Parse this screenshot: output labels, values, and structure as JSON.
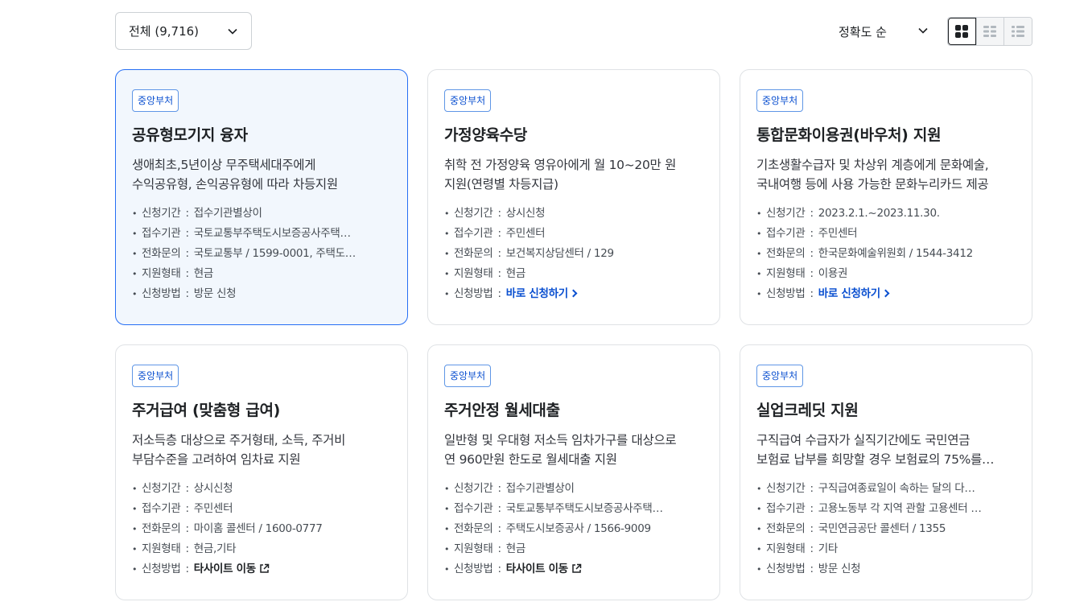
{
  "filter": {
    "label": "전체 (9,716)"
  },
  "sort": {
    "label": "정확도 순"
  },
  "view_modes": [
    "grid-view-icon",
    "compact-grid-icon",
    "list-view-icon"
  ],
  "accent_color": "#256ef4",
  "cards": [
    {
      "badge": "중앙부처",
      "title": "공유형모기지 융자",
      "desc": [
        "생애최초,5년이상 무주택세대주에게",
        "수익공유형, 손익공유형에 따라 차등지원"
      ],
      "period_label": "신청기간",
      "period": "접수기관별상이",
      "agency_label": "접수기관",
      "agency": "국토교통부주택도시보증공사주택…",
      "phone_label": "전화문의",
      "phone": "국토교통부 / 1599-0001, 주택도…",
      "type_label": "지원형태",
      "type": "현금",
      "method_label": "신청방법",
      "method": "방문 신청"
    },
    {
      "badge": "중앙부처",
      "title": "가정양육수당",
      "desc": [
        "취학 전 가정양육 영유아에게 월 10~20만 원",
        "지원(연령별 차등지급)"
      ],
      "period_label": "신청기간",
      "period": "상시신청",
      "agency_label": "접수기관",
      "agency": "주민센터",
      "phone_label": "전화문의",
      "phone": "보건복지상담센터 / 129",
      "type_label": "지원형태",
      "type": "현금",
      "method_label": "신청방법",
      "method": "바로 신청하기"
    },
    {
      "badge": "중앙부처",
      "title": "통합문화이용권(바우처) 지원",
      "desc": [
        "기초생활수급자 및 차상위 계층에게 문화예술,",
        "국내여행 등에 사용 가능한 문화누리카드 제공"
      ],
      "period_label": "신청기간",
      "period": "2023.2.1.~2023.11.30.",
      "agency_label": "접수기관",
      "agency": "주민센터",
      "phone_label": "전화문의",
      "phone": "한국문화예술위원회 / 1544-3412",
      "type_label": "지원형태",
      "type": "이용권",
      "method_label": "신청방법",
      "method": "바로 신청하기"
    },
    {
      "badge": "중앙부처",
      "title": "주거급여 (맞춤형 급여)",
      "desc": [
        "저소득층 대상으로 주거형태, 소득, 주거비",
        "부담수준을 고려하여 임차료 지원"
      ],
      "period_label": "신청기간",
      "period": "상시신청",
      "agency_label": "접수기관",
      "agency": "주민센터",
      "phone_label": "전화문의",
      "phone": "마이홈 콜센터 / 1600-0777",
      "type_label": "지원형태",
      "type": "현금,기타",
      "method_label": "신청방법",
      "method": "타사이트 이동"
    },
    {
      "badge": "중앙부처",
      "title": "주거안정 월세대출",
      "desc": [
        "일반형 및 우대형 저소득 임차가구를 대상으로",
        "연 960만원 한도로 월세대출 지원"
      ],
      "period_label": "신청기간",
      "period": "접수기관별상이",
      "agency_label": "접수기관",
      "agency": "국토교통부주택도시보증공사주택…",
      "phone_label": "전화문의",
      "phone": "주택도시보증공사 / 1566-9009",
      "type_label": "지원형태",
      "type": "현금",
      "method_label": "신청방법",
      "method": "타사이트 이동"
    },
    {
      "badge": "중앙부처",
      "title": "실업크레딧 지원",
      "desc": [
        "구직급여 수급자가 실직기간에도 국민연금",
        "보험료 납부를 희망할 경우 보험료의 75%를…"
      ],
      "period_label": "신청기간",
      "period": "구직급여종료일이 속하는 달의 다…",
      "agency_label": "접수기관",
      "agency": "고용노동부 각 지역 관할 고용센터 …",
      "phone_label": "전화문의",
      "phone": "국민연금공단 콜센터 / 1355",
      "type_label": "지원형태",
      "type": "기타",
      "method_label": "신청방법",
      "method": "방문 신청"
    }
  ]
}
